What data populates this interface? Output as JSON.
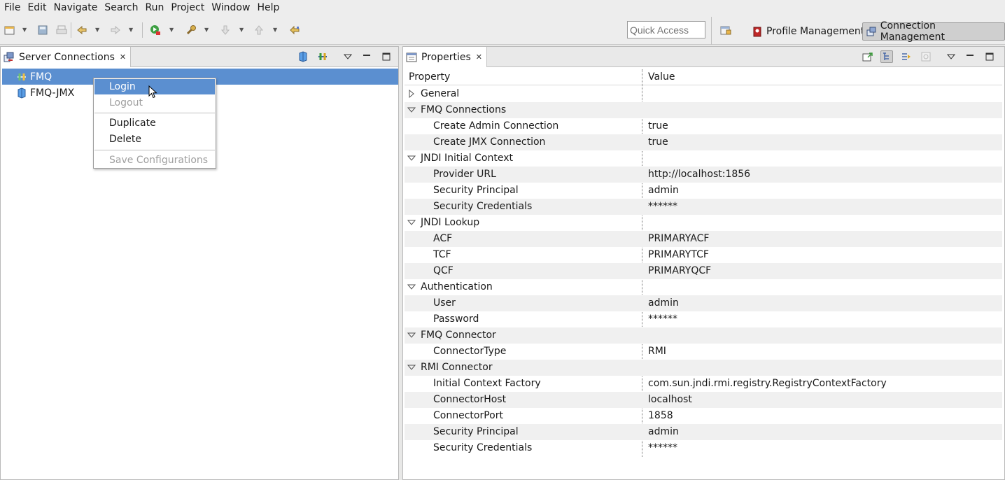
{
  "menu": [
    "File",
    "Edit",
    "Navigate",
    "Search",
    "Run",
    "Project",
    "Window",
    "Help"
  ],
  "toolbar": {
    "quick_access_placeholder": "Quick Access",
    "perspectives": {
      "profile": "Profile Management",
      "connection": "Connection Management"
    }
  },
  "left_panel": {
    "tab_label": "Server Connections",
    "tree": [
      "FMQ",
      "FMQ-JMX"
    ]
  },
  "context_menu": {
    "items": [
      "Login",
      "Logout",
      "Duplicate",
      "Delete",
      "Save Configurations"
    ]
  },
  "right_panel": {
    "tab_label": "Properties",
    "columns": [
      "Property",
      "Value"
    ],
    "rows": [
      {
        "name": "General",
        "value": "",
        "group": true,
        "expanded": false
      },
      {
        "name": "FMQ Connections",
        "value": "",
        "group": true,
        "expanded": true
      },
      {
        "name": "Create Admin Connection",
        "value": "true"
      },
      {
        "name": "Create JMX Connection",
        "value": "true"
      },
      {
        "name": "JNDI Initial Context",
        "value": "",
        "group": true,
        "expanded": true
      },
      {
        "name": "Provider URL",
        "value": "http://localhost:1856"
      },
      {
        "name": "Security Principal",
        "value": "admin"
      },
      {
        "name": "Security Credentials",
        "value": "******"
      },
      {
        "name": "JNDI Lookup",
        "value": "",
        "group": true,
        "expanded": true
      },
      {
        "name": "ACF",
        "value": "PRIMARYACF"
      },
      {
        "name": "TCF",
        "value": "PRIMARYTCF"
      },
      {
        "name": "QCF",
        "value": "PRIMARYQCF"
      },
      {
        "name": "Authentication",
        "value": "",
        "group": true,
        "expanded": true
      },
      {
        "name": "User",
        "value": "admin"
      },
      {
        "name": "Password",
        "value": "******"
      },
      {
        "name": "FMQ Connector",
        "value": "",
        "group": true,
        "expanded": true
      },
      {
        "name": "ConnectorType",
        "value": "RMI"
      },
      {
        "name": "RMI Connector",
        "value": "",
        "group": true,
        "expanded": true
      },
      {
        "name": "Initial Context Factory",
        "value": "com.sun.jndi.rmi.registry.RegistryContextFactory"
      },
      {
        "name": "ConnectorHost",
        "value": "localhost"
      },
      {
        "name": "ConnectorPort",
        "value": "1858"
      },
      {
        "name": "Security Principal",
        "value": "admin"
      },
      {
        "name": "Security Credentials",
        "value": "******"
      }
    ]
  },
  "colors": {
    "selection": "#5b8fd0",
    "row_alt": "#f0f0f0"
  }
}
